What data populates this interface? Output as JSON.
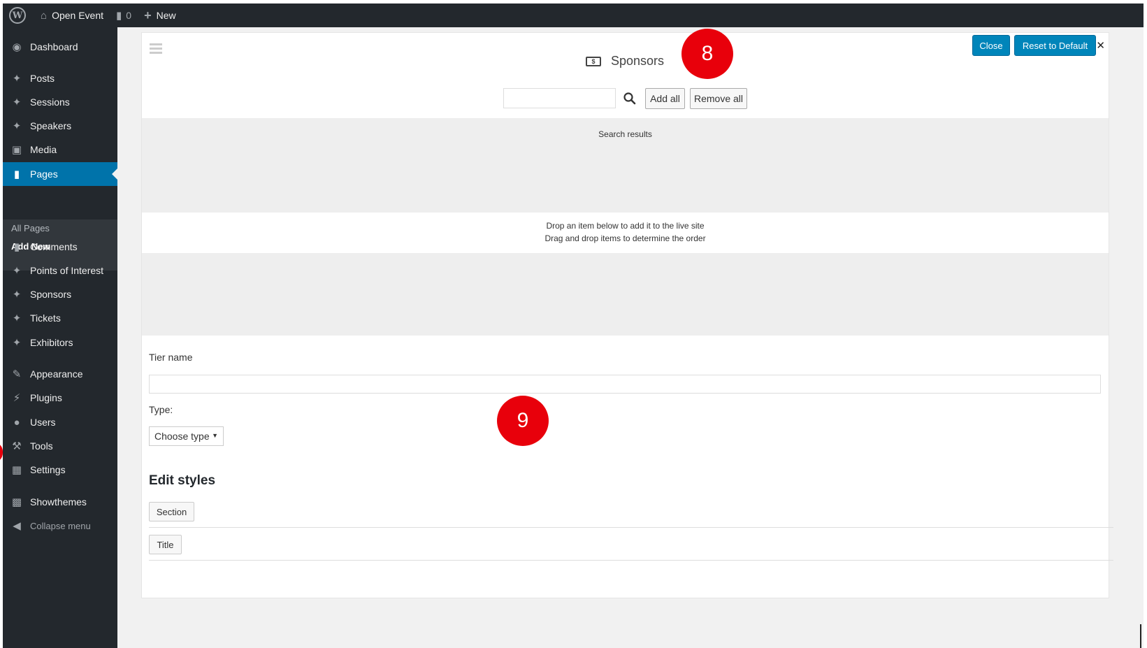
{
  "adminbar": {
    "site_name": "Open Event",
    "comments_count": "0",
    "new_label": "New"
  },
  "sidebar": {
    "items": [
      {
        "label": "Dashboard",
        "icon": "dashboard-icon"
      },
      {
        "label": "Posts",
        "icon": "pin-icon"
      },
      {
        "label": "Sessions",
        "icon": "pin-icon"
      },
      {
        "label": "Speakers",
        "icon": "pin-icon"
      },
      {
        "label": "Media",
        "icon": "media-icon"
      },
      {
        "label": "Pages",
        "icon": "pages-icon"
      },
      {
        "label": "Comments",
        "icon": "comment-icon"
      },
      {
        "label": "Points of Interest",
        "icon": "pin-icon"
      },
      {
        "label": "Sponsors",
        "icon": "pin-icon"
      },
      {
        "label": "Tickets",
        "icon": "pin-icon"
      },
      {
        "label": "Exhibitors",
        "icon": "pin-icon"
      },
      {
        "label": "Appearance",
        "icon": "brush-icon"
      },
      {
        "label": "Plugins",
        "icon": "plugin-icon"
      },
      {
        "label": "Users",
        "icon": "user-icon"
      },
      {
        "label": "Tools",
        "icon": "wrench-icon"
      },
      {
        "label": "Settings",
        "icon": "settings-icon"
      },
      {
        "label": "Showthemes",
        "icon": "image-icon"
      }
    ],
    "submenu": {
      "all_pages": "All Pages",
      "add_new": "Add New"
    },
    "collapse_label": "Collapse menu",
    "active_item": "Pages"
  },
  "panel": {
    "title": "Sponsors",
    "close_label": "Close",
    "reset_label": "Reset to Default",
    "search_value": "",
    "add_all_label": "Add all",
    "remove_all_label": "Remove all",
    "results_label": "Search results",
    "drop_hint_1": "Drop an item below to add it to the live site",
    "drop_hint_2": "Drag and drop items to determine the order",
    "tier_name_label": "Tier name",
    "tier_name_value": "",
    "type_label": "Type:",
    "type_selected": "Choose type",
    "edit_styles_heading": "Edit styles",
    "section_label": "Section",
    "title_label": "Title"
  },
  "annotations": {
    "marker_1": "8",
    "marker_2": "9"
  },
  "colors": {
    "adminbar": "#23282d",
    "sidebar": "#23282d",
    "active": "#0073aa",
    "primary_button": "#0085ba",
    "annotation": "#e8000b"
  }
}
